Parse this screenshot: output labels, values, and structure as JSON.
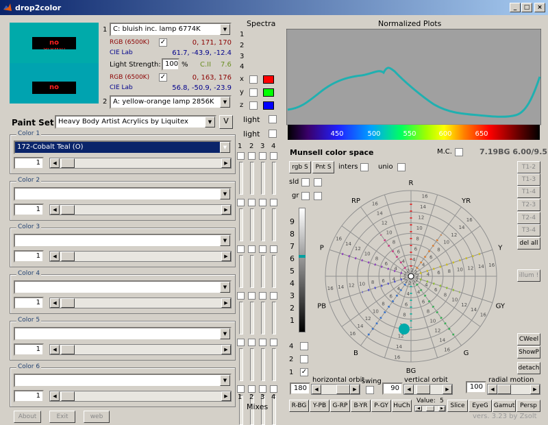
{
  "window": {
    "title": "drop2color",
    "min": "_",
    "max": "□",
    "close": "×"
  },
  "preview": {
    "label_top": "no",
    "label_top2": "Growth",
    "label_bottom": "no",
    "colors": {
      "top": "#00aaaa",
      "bottom": "#00a3b0"
    }
  },
  "light1": {
    "index": "1",
    "lamp": "C: bluish inc. lamp 6774K",
    "rgb_label": "RGB (6500K)",
    "rgb_value": "0,  171,  170",
    "lab_label": "CIE Lab",
    "lab_value": "61.7,  -43.9,  -12.4"
  },
  "strength": {
    "label": "Light Strength:",
    "value": "100",
    "unit": "%",
    "cii_label": "C.II",
    "cii_value": "7.6"
  },
  "light2": {
    "index": "2",
    "lamp": "A: yellow-orange lamp 2856K",
    "rgb_label": "RGB (6500K)",
    "rgb_value": "0,  163,  176",
    "lab_label": "CIE Lab",
    "lab_value": "56.8,  -50.9,  -23.9"
  },
  "spectra": {
    "title": "Spectra",
    "nums": [
      "1",
      "2",
      "3",
      "4"
    ],
    "x": "x",
    "y": "y",
    "z": "z",
    "light1": "light",
    "light2": "light"
  },
  "paint_set": {
    "label": "Paint Set",
    "value": "Heavy Body Artist Acrylics by Liquitex",
    "v_button": "V"
  },
  "colors": [
    {
      "label": "Color 1",
      "value": "172-Cobalt Teal (O)",
      "amount": "1"
    },
    {
      "label": "Color 2",
      "value": "",
      "amount": "1"
    },
    {
      "label": "Color 3",
      "value": "",
      "amount": "1"
    },
    {
      "label": "Color 4",
      "value": "",
      "amount": "1"
    },
    {
      "label": "Color 5",
      "value": "",
      "amount": "1"
    },
    {
      "label": "Color 6",
      "value": "",
      "amount": "1"
    }
  ],
  "mixes": {
    "label": "Mixes",
    "nums": [
      "1",
      "2",
      "3",
      "4"
    ]
  },
  "bottom_buttons": {
    "about": "About",
    "exit": "Exit",
    "web": "web"
  },
  "plot": {
    "title": "Normalized Plots",
    "ticks": [
      "450",
      "500",
      "550",
      "600",
      "650"
    ]
  },
  "munsell": {
    "title": "Munsell color space",
    "mc_label": "M.C.",
    "notation": "7.19BG 6.00/9.5",
    "rgb_s": "rgb S",
    "pnt_s": "Pnt S",
    "inters": "inters",
    "unio": "unio",
    "sld": "sld",
    "gr": "gr",
    "hues": [
      "R",
      "YR",
      "Y",
      "GY",
      "G",
      "BG",
      "B",
      "PB",
      "P",
      "RP"
    ],
    "value_ticks": [
      "9",
      "8",
      "7",
      "6",
      "5",
      "4",
      "3",
      "2",
      "1"
    ],
    "chroma_ticks": [
      "16",
      "14",
      "12",
      "10",
      "8",
      "6",
      "4",
      "2"
    ],
    "mode_nums": [
      "4",
      "2",
      "1"
    ]
  },
  "side_buttons": [
    "T1-2",
    "T1-3",
    "T1-4",
    "T2-3",
    "T2-4",
    "T3-4",
    "del all",
    "illum !",
    "CWeel",
    "ShowP",
    "detach"
  ],
  "orbit": {
    "h_label": "horizontal orbit",
    "h_value": "180",
    "swing": "swing",
    "v_label": "vertical orbit",
    "v_value": "90",
    "r_label": "radial motion",
    "r_value": "100"
  },
  "bottom_row": [
    "R-BG",
    "Y-PB",
    "G-RP",
    "B-YR",
    "P-GY",
    "HuCh"
  ],
  "value_ctrl": {
    "label": "Value:",
    "value": "5"
  },
  "right_row": [
    "Slice",
    "EyeG",
    "Gamut",
    "Persp"
  ],
  "version": "vers. 3.23 by Zsolt"
}
